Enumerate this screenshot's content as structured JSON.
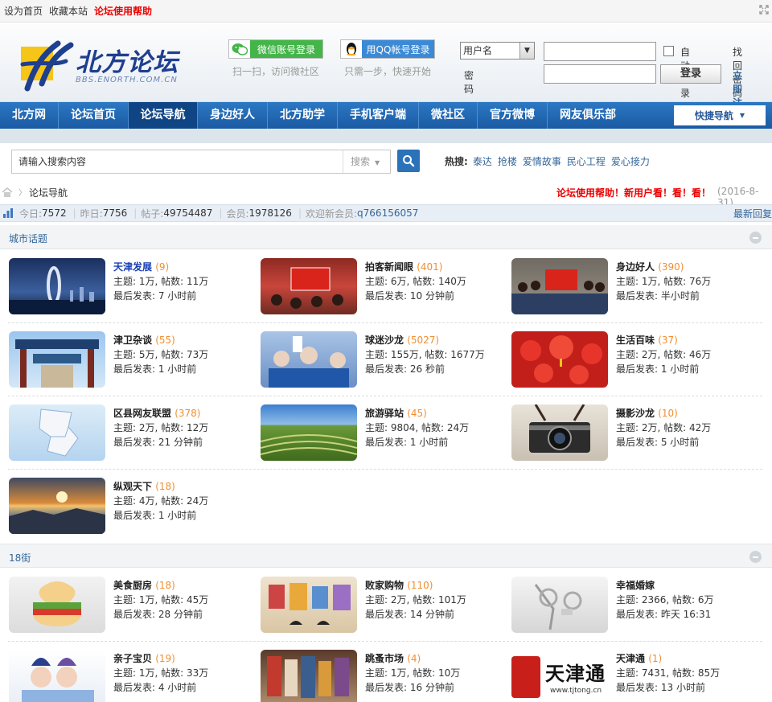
{
  "topbar": {
    "set_home": "设为首页",
    "bookmark": "收藏本站",
    "help": "论坛使用帮助"
  },
  "logo": {
    "name": "北方论坛",
    "sub": "BBS.ENORTH.COM.CN"
  },
  "social": {
    "wechat_label": "微信账号登录",
    "wechat_hint": "扫一扫，访问微社区",
    "qq_label": "用QQ帐号登录",
    "qq_hint": "只需一步，快速开始"
  },
  "login": {
    "field_select": "用户名",
    "password_label": "密码",
    "auto_login": "自动登录",
    "submit": "登录",
    "find_password": "找回密码",
    "register": "立即注册"
  },
  "nav": {
    "items": [
      "北方网",
      "论坛首页",
      "论坛导航",
      "身边好人",
      "北方助学",
      "手机客户端",
      "微社区",
      "官方微博",
      "网友俱乐部"
    ],
    "quick": "快捷导航"
  },
  "search": {
    "placeholder": "请输入搜索内容",
    "scope": "搜索",
    "hot_label": "热搜:",
    "hot_words": [
      "泰达",
      "抢楼",
      "爱情故事",
      "民心工程",
      "爱心接力"
    ]
  },
  "breadcrumb": {
    "current": "论坛导航",
    "notice": "论坛使用帮助！新用户看！看！看！",
    "date": "(2016-8-31)"
  },
  "stats": {
    "today_label": "今日:",
    "today": "7572",
    "yesterday_label": "昨日:",
    "yesterday": "7756",
    "posts_label": "帖子:",
    "posts": "49754487",
    "members_label": "会员:",
    "members": "1978126",
    "welcome_label": "欢迎新会员:",
    "newest": "q766156057",
    "latest_reply": "最新回复"
  },
  "sections": {
    "city": {
      "title": "城市话题",
      "forums": [
        {
          "name": "天津发展",
          "count": "(9)",
          "stat": "主题: 1万, 帖数: 11万",
          "last": "最后发表: 7 小时前"
        },
        {
          "name": "拍客新闻眼",
          "count": "(401)",
          "stat": "主题: 6万, 帖数: 140万",
          "last": "最后发表: 10 分钟前"
        },
        {
          "name": "身边好人",
          "count": "(390)",
          "stat": "主题: 1万, 帖数: 76万",
          "last": "最后发表: 半小时前"
        },
        {
          "name": "津卫杂谈",
          "count": "(55)",
          "stat": "主题: 5万, 帖数: 73万",
          "last": "最后发表: 1 小时前"
        },
        {
          "name": "球迷沙龙",
          "count": "(5027)",
          "stat": "主题: 155万, 帖数: 1677万",
          "last": "最后发表: 26 秒前"
        },
        {
          "name": "生活百味",
          "count": "(37)",
          "stat": "主题: 2万, 帖数: 46万",
          "last": "最后发表: 1 小时前"
        },
        {
          "name": "区县网友联盟",
          "count": "(378)",
          "stat": "主题: 2万, 帖数: 12万",
          "last": "最后发表: 21 分钟前"
        },
        {
          "name": "旅游驿站",
          "count": "(45)",
          "stat": "主题: 9804, 帖数: 24万",
          "last": "最后发表: 1 小时前"
        },
        {
          "name": "摄影沙龙",
          "count": "(10)",
          "stat": "主题: 2万, 帖数: 42万",
          "last": "最后发表: 5 小时前"
        },
        {
          "name": "纵观天下",
          "count": "(18)",
          "stat": "主题: 4万, 帖数: 24万",
          "last": "最后发表: 1 小时前"
        }
      ]
    },
    "street": {
      "title": "18街",
      "forums": [
        {
          "name": "美食厨房",
          "count": "(18)",
          "stat": "主题: 1万, 帖数: 45万",
          "last": "最后发表: 28 分钟前"
        },
        {
          "name": "败家购物",
          "count": "(110)",
          "stat": "主题: 2万, 帖数: 101万",
          "last": "最后发表: 14 分钟前"
        },
        {
          "name": "幸福婚嫁",
          "count": "",
          "stat": "主题: 2366, 帖数: 6万",
          "last": "最后发表: 昨天 16:31"
        },
        {
          "name": "亲子宝贝",
          "count": "(19)",
          "stat": "主题: 1万, 帖数: 33万",
          "last": "最后发表: 4 小时前"
        },
        {
          "name": "跳蚤市场",
          "count": "(4)",
          "stat": "主题: 1万, 帖数: 10万",
          "last": "最后发表: 16 分钟前"
        },
        {
          "name": "天津通",
          "count": "(1)",
          "stat": "主题: 7431, 帖数: 85万",
          "last": "最后发表: 13 小时前"
        }
      ]
    }
  },
  "tianjintong_logo": {
    "text": "天津通",
    "url": "www.tjtong.cn"
  },
  "colors": {
    "nav": "#1f66b3",
    "accent_red": "#e00000",
    "count_orange": "#f08f31",
    "link_blue": "#336699"
  }
}
